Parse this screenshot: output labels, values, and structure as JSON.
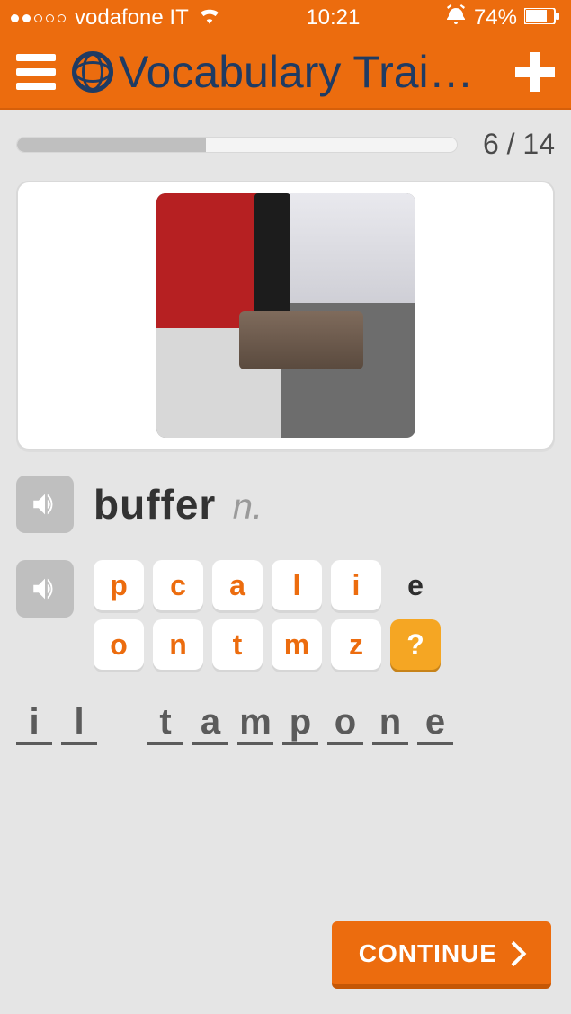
{
  "status": {
    "carrier": "vodafone IT",
    "time": "10:21",
    "battery": "74%"
  },
  "header": {
    "title": "Vocabulary Trai…"
  },
  "progress": {
    "label": "6 / 14",
    "percent": 42.85
  },
  "word": {
    "headword": "buffer",
    "pos": "n."
  },
  "tiles": {
    "row1": [
      "p",
      "c",
      "a",
      "l",
      "i",
      "e",
      "o"
    ],
    "used": [
      "e"
    ],
    "row2": [
      "n",
      "t",
      "m",
      "z",
      "?"
    ]
  },
  "answer": {
    "letters": [
      "i",
      "l",
      " ",
      "t",
      "a",
      "m",
      "p",
      "o",
      "n",
      "e"
    ]
  },
  "continue": {
    "label": "CONTINUE"
  }
}
